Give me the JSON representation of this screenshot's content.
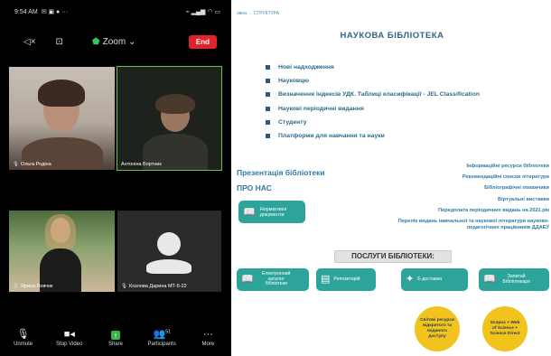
{
  "phone": {
    "status_time": "9:54 AM",
    "zoom_title": "Zoom",
    "end_label": "End",
    "participants_tiles": [
      {
        "name": "Ольга Родіна"
      },
      {
        "name": "Антоніна Бортник"
      },
      {
        "name": "Ярина Вовчок"
      },
      {
        "name": "Козлова Дарина МТ-5-22"
      }
    ],
    "toolbar": [
      {
        "label": "Unmute",
        "icon": "mic-icon"
      },
      {
        "label": "Stop Video",
        "icon": "video-icon"
      },
      {
        "label": "Share",
        "icon": "share-icon"
      },
      {
        "label": "Participants",
        "icon": "participants-icon",
        "count": "51"
      },
      {
        "label": "More",
        "icon": "more-icon"
      }
    ]
  },
  "site": {
    "breadcrumb": "овна → СТРУКТУРА",
    "title": "НАУКОВА БІБЛІОТЕКА",
    "menu": [
      "Нові надходження",
      "Науковцю",
      "Визначення індексів УДК. Таблиці класифікації - JEL Classification",
      "Наукові періодичні видання",
      "Студенту",
      "Платформи для навчання та науки"
    ],
    "left_links": [
      "Презентація бібліотеки",
      "ПРО НАС"
    ],
    "norm_button": "Нормативні документи",
    "right_links": [
      "Інформаційні ресурси бібліотеки",
      "Рекомендаційні списки літератури",
      "Бібліографічні покажчики",
      "Віртуальні виставки",
      "Передплата періодичних видань на 2021 рік",
      "Перелік видань навчальної та наукової літератури науково-педагогічних працівників ДДАЕУ"
    ],
    "services_title": "ПОСЛУГИ БІБЛІОТЕКИ:",
    "services": [
      {
        "label": "Електронний каталог бібліотеки"
      },
      {
        "label": "Репозитарій"
      },
      {
        "label": "Е-доставка"
      },
      {
        "label": "Запитай Бібліотекаря"
      }
    ],
    "circles": [
      {
        "label": "Світові ресурси відкритого та наданого доступу"
      },
      {
        "label": "Scopus + Web of Science + Science Direct"
      }
    ],
    "colors": {
      "accent": "#2ca49a",
      "title": "#2f6689",
      "circle": "#f2c31c"
    }
  }
}
